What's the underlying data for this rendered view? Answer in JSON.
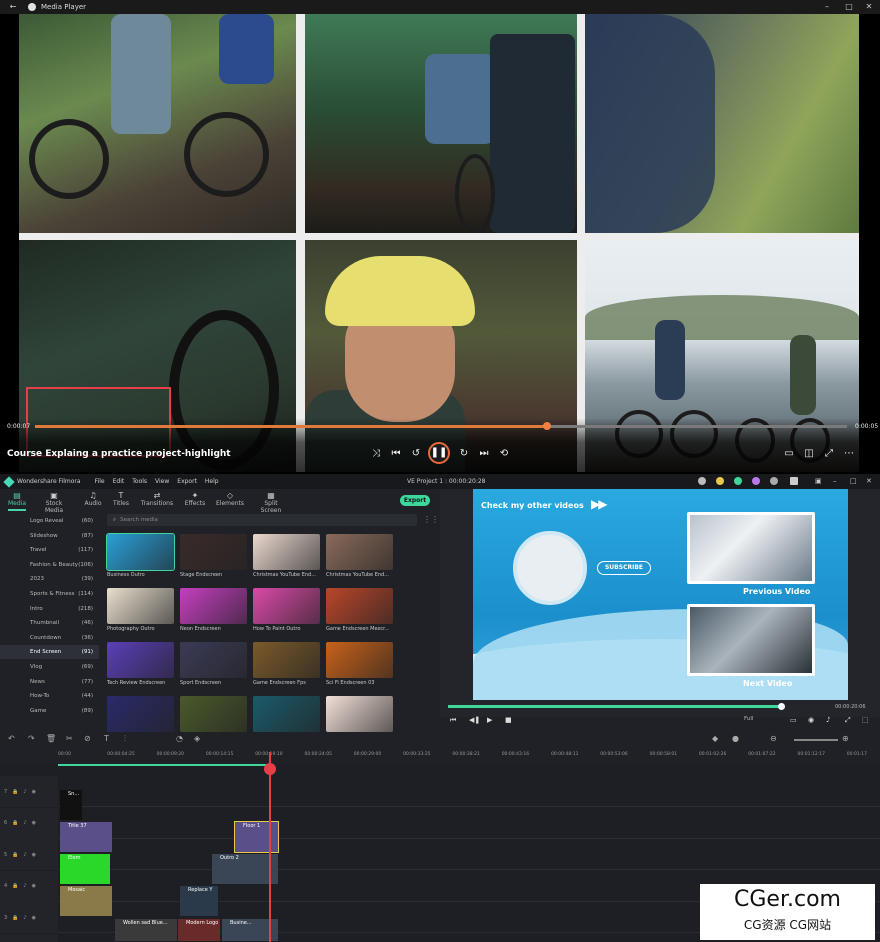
{
  "media_player": {
    "window_title": "Media Player",
    "current_time": "0:00:07",
    "remaining_time": "0:00:05",
    "progress_fraction": 0.63,
    "caption": "Course Explaing a practice project-highlight"
  },
  "filmora": {
    "app_name": "Wondershare Filmora",
    "menu": [
      "File",
      "Edit",
      "Tools",
      "View",
      "Export",
      "Help"
    ],
    "project_title": "VE Project 1 : 00:00:20:28",
    "tabs": [
      {
        "label": "Media",
        "icon": "media-icon",
        "active": true
      },
      {
        "label": "Stock Media",
        "icon": "stock-media-icon"
      },
      {
        "label": "Audio",
        "icon": "audio-icon"
      },
      {
        "label": "Titles",
        "icon": "titles-icon"
      },
      {
        "label": "Transitions",
        "icon": "transitions-icon"
      },
      {
        "label": "Effects",
        "icon": "effects-icon"
      },
      {
        "label": "Elements",
        "icon": "elements-icon"
      },
      {
        "label": "Split Screen",
        "icon": "split-screen-icon"
      }
    ],
    "export_label": "Export",
    "search_placeholder": "Search media",
    "categories": [
      {
        "label": "Logo Reveal",
        "count": "(60)"
      },
      {
        "label": "Slideshow",
        "count": "(87)"
      },
      {
        "label": "Travel",
        "count": "(117)"
      },
      {
        "label": "Fashion & Beauty",
        "count": "(106)"
      },
      {
        "label": "2023",
        "count": "(39)"
      },
      {
        "label": "Sports & Fitness",
        "count": "(114)"
      },
      {
        "label": "Intro",
        "count": "(218)"
      },
      {
        "label": "Thumbnail",
        "count": "(46)"
      },
      {
        "label": "Countdown",
        "count": "(36)"
      },
      {
        "label": "End Screen",
        "count": "(91)",
        "active": true
      },
      {
        "label": "Vlog",
        "count": "(69)"
      },
      {
        "label": "News",
        "count": "(77)"
      },
      {
        "label": "How-To",
        "count": "(44)"
      },
      {
        "label": "Game",
        "count": "(89)"
      }
    ],
    "media_tiles": [
      {
        "label": "Business Outro",
        "color": "#2a9fd8",
        "selected": true
      },
      {
        "label": "Stage Endscreen",
        "color": "#3a2a2a"
      },
      {
        "label": "Christmas YouTube End...",
        "color": "#e9d8cf"
      },
      {
        "label": "Christmas YouTube End...",
        "color": "#8a6a5a"
      },
      {
        "label": "Photography Outro",
        "color": "#e9dfcf"
      },
      {
        "label": "Neon Endscreen",
        "color": "#c43fbf"
      },
      {
        "label": "How To Paint Outro",
        "color": "#d94aa8"
      },
      {
        "label": "Game Endscreen Mexcr...",
        "color": "#b8462a"
      },
      {
        "label": "Tech Review Endscreen",
        "color": "#5a3fb8"
      },
      {
        "label": "Sport Endscreen",
        "color": "#3a3a56"
      },
      {
        "label": "Game Endscreen Fps",
        "color": "#7a5a2a"
      },
      {
        "label": "Sci Fi Endscreen 03",
        "color": "#c8621a"
      },
      {
        "label": "",
        "color": "#2a2a6a"
      },
      {
        "label": "",
        "color": "#4a5a2a"
      },
      {
        "label": "",
        "color": "#1a5a6a"
      },
      {
        "label": "",
        "color": "#f2e0d8"
      }
    ],
    "preview": {
      "heading": "Check my other videos",
      "arrows": "▶▶",
      "subscribe": "SUBSCRIBE",
      "previous_label": "Previous Video",
      "next_label": "Next Video",
      "time": "00:00:20:06",
      "progress_fraction": 0.99,
      "quality": "Full"
    },
    "ruler_ticks": [
      "00:00",
      "00:00:04:25",
      "00:00:09:20",
      "00:00:14:15",
      "00:00:19:10",
      "00:00:24:05",
      "00:00:29:00",
      "00:00:33:25",
      "00:00:38:21",
      "00:00:43:16",
      "00:00:48:11",
      "00:00:53:06",
      "00:00:58:01",
      "00:01:02:26",
      "00:01:07:22",
      "00:01:12:17",
      "00:01:17"
    ],
    "tracks": [
      {
        "num": "7"
      },
      {
        "num": "6"
      },
      {
        "num": "5"
      },
      {
        "num": "4"
      },
      {
        "num": "3"
      },
      {
        "num": "2"
      }
    ],
    "clips": [
      {
        "label": "Sn...",
        "color": "#111111"
      },
      {
        "label": "Title 37",
        "color": "#5b4f8a"
      },
      {
        "label": "Floor 1",
        "color": "#5b4f8a"
      },
      {
        "label": "Elem",
        "color": "#2ad82a"
      },
      {
        "label": "Outro 2",
        "color": "#3a4656"
      },
      {
        "label": "Mosaic",
        "color": "#8a7a4a"
      },
      {
        "label": "Replace Y",
        "color": "#2a3a4a"
      },
      {
        "label": "Wollen sad Blue...",
        "color": "#3a3a3a"
      },
      {
        "label": "Modern Logo Re...",
        "color": "#6a2a2a"
      },
      {
        "label": "Busine...",
        "color": "#3a4656"
      }
    ]
  },
  "watermark": {
    "big": "CGer.com",
    "small": "CG资源 CG网站"
  }
}
